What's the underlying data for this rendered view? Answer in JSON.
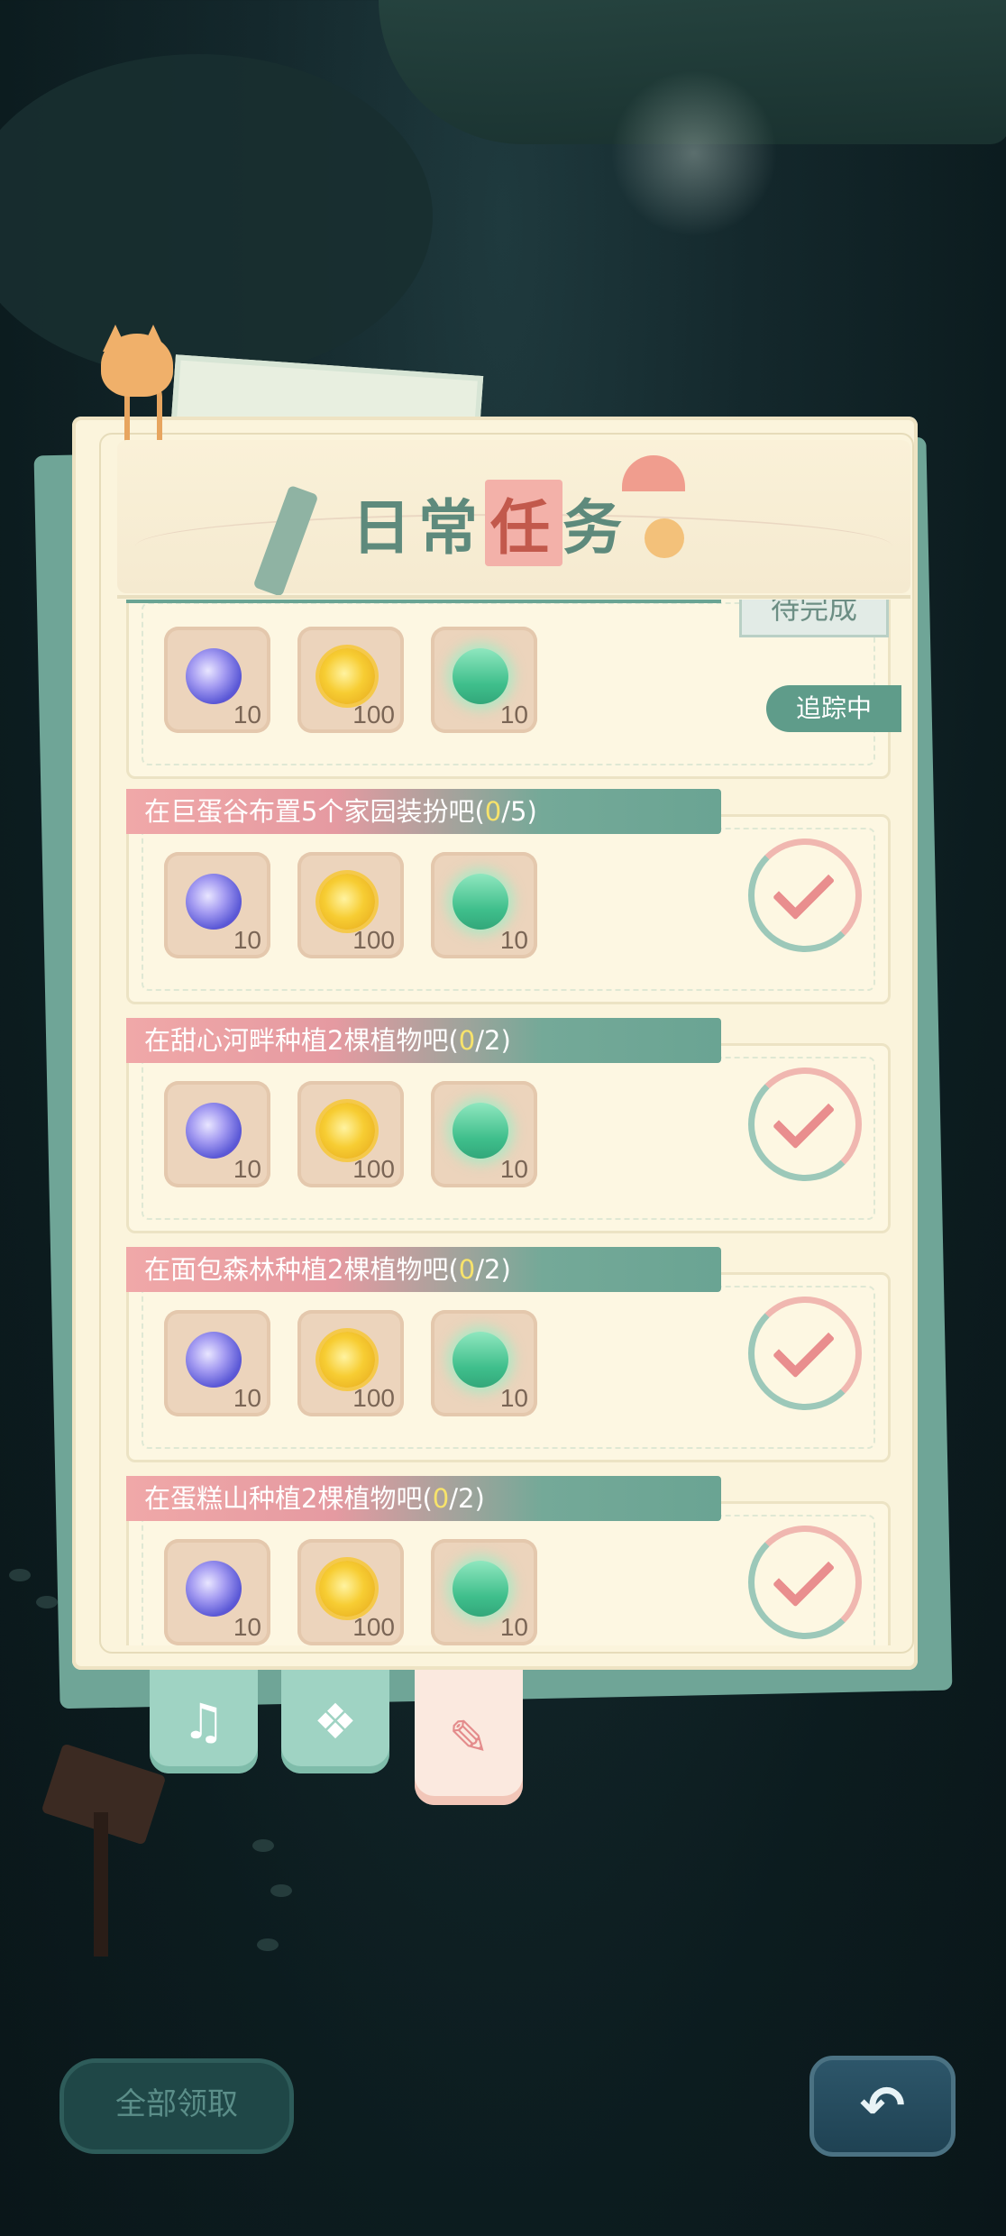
{
  "title": {
    "prefix": "日常",
    "highlight": "任",
    "suffix": "务"
  },
  "first_task": {
    "status": "待完成",
    "tracking": "追踪中",
    "rewards": [
      {
        "icon": "moon-token-icon",
        "amount": "10"
      },
      {
        "icon": "gold-coin-icon",
        "amount": "100"
      },
      {
        "icon": "green-gem-icon",
        "amount": "10"
      }
    ]
  },
  "tasks": [
    {
      "text": "在巨蛋谷布置5个家园装扮吧(",
      "progress": "0",
      "total": "/5)",
      "rewards": [
        {
          "icon": "moon-token-icon",
          "amount": "10"
        },
        {
          "icon": "gold-coin-icon",
          "amount": "100"
        },
        {
          "icon": "green-gem-icon",
          "amount": "10"
        }
      ]
    },
    {
      "text": "在甜心河畔种植2棵植物吧(",
      "progress": "0",
      "total": "/2)",
      "rewards": [
        {
          "icon": "moon-token-icon",
          "amount": "10"
        },
        {
          "icon": "gold-coin-icon",
          "amount": "100"
        },
        {
          "icon": "green-gem-icon",
          "amount": "10"
        }
      ]
    },
    {
      "text": "在面包森林种植2棵植物吧(",
      "progress": "0",
      "total": "/2)",
      "rewards": [
        {
          "icon": "moon-token-icon",
          "amount": "10"
        },
        {
          "icon": "gold-coin-icon",
          "amount": "100"
        },
        {
          "icon": "green-gem-icon",
          "amount": "10"
        }
      ]
    },
    {
      "text": "在蛋糕山种植2棵植物吧(",
      "progress": "0",
      "total": "/2)",
      "rewards": [
        {
          "icon": "moon-token-icon",
          "amount": "10"
        },
        {
          "icon": "gold-coin-icon",
          "amount": "100"
        },
        {
          "icon": "green-gem-icon",
          "amount": "10"
        }
      ]
    }
  ],
  "tabs": [
    {
      "icon": "music-note-icon",
      "active": false
    },
    {
      "icon": "paw-book-icon",
      "active": false
    },
    {
      "icon": "task-list-icon",
      "active": true
    }
  ],
  "buttons": {
    "claim_all": "全部领取",
    "back_icon": "back-arrow-icon"
  },
  "colors": {
    "background": "#0c1c1f",
    "paper": "#fbf4dc",
    "accent_green": "#6aa493",
    "accent_pink": "#f0a8a8",
    "progress_yellow": "#f7e36b"
  }
}
